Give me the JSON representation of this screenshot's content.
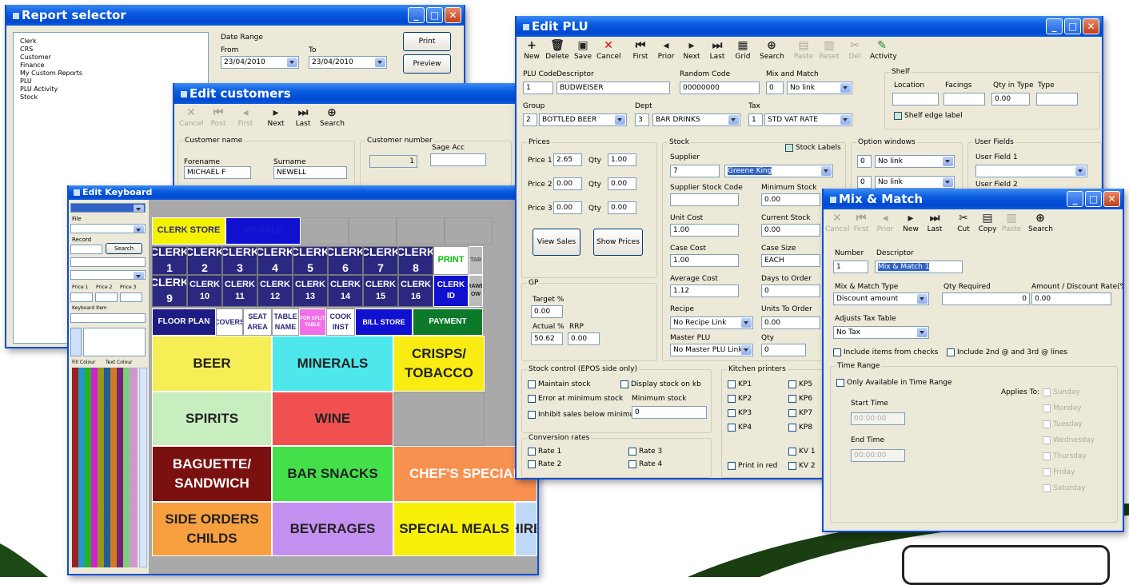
{
  "report": {
    "title": "Report selector",
    "tree": [
      "Clerk",
      "CRS",
      "Customer",
      "Finance",
      "My Custom Reports",
      "PLU",
      "PLU Activity",
      "Stock"
    ],
    "date_range": "Date Range",
    "from": "From",
    "to": "To",
    "from_date": "23/04/2010",
    "to_date": "23/04/2010",
    "print": "Print",
    "preview": "Preview"
  },
  "customers": {
    "title": "Edit customers",
    "toolbar": [
      "Cancel",
      "Post",
      "First",
      "Next",
      "Last",
      "Search"
    ],
    "customer_name": "Customer name",
    "forename_label": "Forename",
    "forename": "MICHAEL F",
    "surname_label": "Surname",
    "surname": "NEWELL",
    "customer_number_label": "Customer number",
    "customer_number": "1",
    "sage_label": "Sage Acc"
  },
  "keyboard": {
    "title": "Edit Keyboard",
    "file_label": "File",
    "record_label": "Record",
    "search": "Search",
    "price_labels": [
      "Price 1",
      "Price 2",
      "Price 3"
    ],
    "keyboard_label": "Keyboard Item",
    "colour_labels": [
      "Fill Colour",
      "Text Colour"
    ],
    "row1": [
      "CLERK STORE",
      "NO SALE"
    ],
    "clerks_a": [
      "CLERK 1",
      "CLERK 2",
      "CLERK 3",
      "CLERK 4",
      "CLERK 5",
      "CLERK 6",
      "CLERK 7",
      "CLERK 8"
    ],
    "print": "PRINT",
    "side_a": "TAB",
    "clerk9": "CLERK 9",
    "clerks_b": [
      "CLERK 10",
      "CLERK 11",
      "CLERK 12",
      "CLERK 13",
      "CLERK 14",
      "CLERK 15",
      "CLERK 16"
    ],
    "clerk_id": "CLERK ID",
    "side_b": "DRAWER OW",
    "func": [
      "FLOOR PLAN",
      "COVERS",
      "SEAT AREA",
      "TABLE NAME",
      "FOR SPLIT TABLE",
      "COOK INST",
      "BILL STORE",
      "PAYMENT"
    ],
    "cats": [
      "BEER",
      "MINERALS",
      "CRISPS/ TOBACCO",
      "SPIRITS",
      "WINE",
      "BAGUETTE/ SANDWICH",
      "BAR SNACKS",
      "CHEF'S SPECIAL",
      "SIDE ORDERS CHILDS",
      "BEVERAGES",
      "SPECIAL MEALS",
      "HIRE"
    ],
    "colors": {
      "beer": "#f5ee55",
      "minerals": "#4ee8ec",
      "crisps": "#f8ec12",
      "spirits": "#c8eec0",
      "wine": "#f05050",
      "baguette": "#7a1010",
      "barsnacks": "#44e04a",
      "chefs": "#f89050",
      "side": "#f8a040",
      "bev": "#c490f0",
      "special": "#f8f008",
      "hire": "#c0d8f8"
    }
  },
  "plu": {
    "title": "Edit PLU",
    "toolbar": [
      "New",
      "Delete",
      "Save",
      "Cancel",
      "First",
      "Prior",
      "Next",
      "Last",
      "Grid",
      "Search",
      "Paste",
      "Reset",
      "Del",
      "Activity"
    ],
    "plu_code_label": "PLU Code",
    "plu_code": "1",
    "desc_label": "Descriptor",
    "desc": "BUDWEISER",
    "random_label": "Random Code",
    "random": "00000000",
    "mix_label": "Mix and Match",
    "mix_num": "0",
    "mix_val": "No link",
    "group_label": "Group",
    "group_num": "2",
    "group_val": "BOTTLED BEER",
    "dept_label": "Dept",
    "dept_num": "3",
    "dept_val": "BAR DRINKS",
    "tax_label": "Tax",
    "tax_num": "1",
    "tax_val": "STD VAT RATE",
    "shelf": "Shelf",
    "location": "Location",
    "facings": "Facings",
    "qty_type": "Qty in Type",
    "type": "Type",
    "qty_val": "0.00",
    "shelf_edge": "Shelf edge label",
    "prices": "Prices",
    "price1": "Price 1",
    "price2": "Price 2",
    "price3": "Price 3",
    "p1": "2.65",
    "p2": "0.00",
    "p3": "0.00",
    "qty": "Qty",
    "q1": "1.00",
    "q2": "0.00",
    "q3": "0.00",
    "view_sales": "View Sales",
    "show_prices": "Show Prices",
    "gp": "GP",
    "target": "Target %",
    "target_val": "0.00",
    "actual": "Actual %",
    "actual_val": "50.62",
    "rrp": "RRP",
    "rrp_val": "0.00",
    "stock": "Stock",
    "stock_labels": "Stock Labels",
    "supplier": "Supplier",
    "supplier_num": "7",
    "supplier_val": "Greene King",
    "supp_code": "Supplier Stock Code",
    "min_stock": "Minimum Stock",
    "min_val": "0.00",
    "unit_cost": "Unit Cost",
    "unit_val": "1.00",
    "current": "Current Stock",
    "current_val": "0.00",
    "case_cost": "Case Cost",
    "case_val": "1.00",
    "case_size": "Case Size",
    "case_size_val": "EACH",
    "avg_cost": "Average Cost",
    "avg_val": "1.12",
    "days": "Days to Order",
    "days_val": "0",
    "recipe": "Recipe",
    "recipe_val": "No Recipe Link",
    "units": "Units To Order",
    "units_val": "0.00",
    "master": "Master PLU",
    "master_val": "No Master PLU Link",
    "qty2": "Qty",
    "qty2_val": "0",
    "option": "Option windows",
    "opt1": "0",
    "opt1v": "No link",
    "opt2": "0",
    "opt2v": "No link",
    "user": "User Fields",
    "uf1": "User Field 1",
    "uf2": "User Field 2",
    "stock_ctrl": "Stock control (EPOS side only)",
    "sc": [
      "Maintain stock",
      "Display stock on kb",
      "Error at minimum stock",
      "Inhibit sales below minimum"
    ],
    "min_s": "Minimum stock",
    "min_s_val": "0",
    "conv": "Conversion rates",
    "rates": [
      "Rate 1",
      "Rate 2",
      "Rate 3",
      "Rate 4"
    ],
    "kp": "Kitchen printers",
    "kps": [
      "KP1",
      "KP2",
      "KP3",
      "KP4",
      "KP5",
      "KP6",
      "KP7",
      "KP8",
      "KV 1",
      "KV 2"
    ],
    "print_red": "Print in red"
  },
  "mix": {
    "title": "Mix & Match",
    "toolbar": [
      "Cancel",
      "First",
      "Prior",
      "New",
      "Last",
      "Cut",
      "Copy",
      "Paste",
      "Search"
    ],
    "number_label": "Number",
    "number": "1",
    "desc_label": "Descriptor",
    "desc": "Mix & Match 1",
    "type_label": "Mix & Match Type",
    "type_val": "Discount amount",
    "qty_label": "Qty Required",
    "qty_val": "0",
    "amount_label": "Amount / Discount Rate(%)",
    "amount_val": "0.00",
    "tax_label": "Adjusts Tax Table",
    "tax_val": "No Tax",
    "incl1": "Include items from checks",
    "incl2": "Include 2nd @ and 3rd @ lines",
    "time_range": "Time Range",
    "only": "Only Available in Time Range",
    "applies": "Applies To:",
    "start": "Start Time",
    "start_val": "00:00:00",
    "end": "End Time",
    "end_val": "00:00:00",
    "days": [
      "Sunday",
      "Monday",
      "Tuesday",
      "Wednesday",
      "Thursday",
      "Friday",
      "Saturday"
    ]
  }
}
